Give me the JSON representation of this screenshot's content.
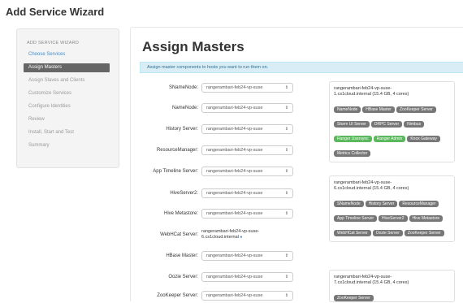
{
  "window": {
    "title": "Add Service Wizard"
  },
  "sidebar": {
    "heading": "ADD SERVICE WIZARD",
    "items": [
      {
        "label": "Choose Services",
        "state": "link"
      },
      {
        "label": "Assign Masters",
        "state": "active"
      },
      {
        "label": "Assign Slaves and Clients",
        "state": "disabled"
      },
      {
        "label": "Customize Services",
        "state": "disabled"
      },
      {
        "label": "Configure Identities",
        "state": "disabled"
      },
      {
        "label": "Review",
        "state": "disabled"
      },
      {
        "label": "Install, Start and Test",
        "state": "disabled"
      },
      {
        "label": "Summary",
        "state": "disabled"
      }
    ]
  },
  "main": {
    "title": "Assign Masters",
    "info": "Assign master components to hosts you want to run them on.",
    "assignments": [
      {
        "label": "SNameNode:",
        "host": "rangerambari-feb24-vp-suse"
      },
      {
        "label": "NameNode:",
        "host": "rangerambari-feb24-vp-suse"
      },
      {
        "label": "History Server:",
        "host": "rangerambari-feb24-vp-suse"
      },
      {
        "label": "ResourceManager:",
        "host": "rangerambari-feb24-vp-suse"
      },
      {
        "label": "App Timeline Server:",
        "host": "rangerambari-feb24-vp-suse"
      },
      {
        "label": "HiveServer2:",
        "host": "rangerambari-feb24-vp-suse"
      },
      {
        "label": "Hive Metastore:",
        "host": "rangerambari-feb24-vp-suse"
      },
      {
        "label": "WebHCat Server:",
        "host_line1": "rangerambari-feb24-vp-suse-",
        "host_line2": "6.cs1cloud.internal"
      },
      {
        "label": "HBase Master:",
        "host": "rangerambari-feb24-vp-suse"
      },
      {
        "label": "Oozie Server:",
        "host": "rangerambari-feb24-vp-suse"
      },
      {
        "label": "ZooKeeper Server:",
        "host": "rangerambari-feb24-vp-suse"
      }
    ]
  },
  "hosts": [
    {
      "name_line1": "rangerambari-feb24-vp-suse-",
      "name_line2": "1.cs1cloud.internal (15.4 GB, 4 cores)",
      "components": [
        {
          "label": "NameNode",
          "color": "#777777"
        },
        {
          "label": "HBase Master",
          "color": "#777777"
        },
        {
          "label": "ZooKeeper Server",
          "color": "#777777"
        },
        {
          "label": "Storm UI Server",
          "color": "#777777"
        },
        {
          "label": "DRPC Server",
          "color": "#777777"
        },
        {
          "label": "Nimbus",
          "color": "#777777"
        },
        {
          "label": "Ranger Usersync",
          "color": "#5cb85c"
        },
        {
          "label": "Ranger Admin",
          "color": "#5cb85c"
        },
        {
          "label": "Knox Gateway",
          "color": "#777777"
        },
        {
          "label": "Metrics Collector",
          "color": "#777777"
        }
      ]
    },
    {
      "name_line1": "rangerambari-feb24-vp-suse-",
      "name_line2": "6.cs1cloud.internal (15.4 GB, 4 cores)",
      "components": [
        {
          "label": "SNameNode",
          "color": "#777777"
        },
        {
          "label": "History Server",
          "color": "#777777"
        },
        {
          "label": "ResourceManager",
          "color": "#777777"
        },
        {
          "label": "App Timeline Server",
          "color": "#777777"
        },
        {
          "label": "HiveServer2",
          "color": "#777777"
        },
        {
          "label": "Hive Metastore",
          "color": "#777777"
        },
        {
          "label": "WebHCat Server",
          "color": "#777777"
        },
        {
          "label": "Oozie Server",
          "color": "#777777"
        },
        {
          "label": "ZooKeeper Server",
          "color": "#777777"
        }
      ]
    },
    {
      "name_line1": "rangerambari-feb24-vp-suse-",
      "name_line2": "7.cs1cloud.internal (15.4 GB, 4 cores)",
      "components": [
        {
          "label": "ZooKeeper Server",
          "color": "#777777"
        }
      ]
    }
  ],
  "icons": {
    "select_caret": "up-down-caret-icon",
    "help": "question-icon"
  }
}
